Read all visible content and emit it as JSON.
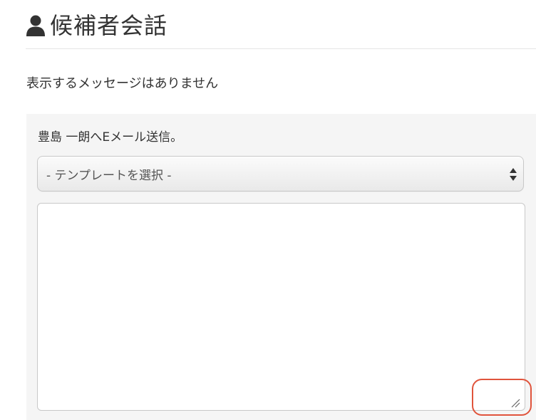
{
  "header": {
    "title": "候補者会話",
    "icon": "user-icon"
  },
  "messages": {
    "empty_text": "表示するメッセージはありません"
  },
  "compose": {
    "heading": "豊島 一朗へEメール送信。",
    "template_select": {
      "selected": "- テンプレートを選択 -",
      "icon": "select-arrows-icon"
    },
    "textarea": {
      "value": "",
      "resize_icon": "resize-grip-icon"
    }
  },
  "annotation": {
    "color": "#e0543c"
  }
}
